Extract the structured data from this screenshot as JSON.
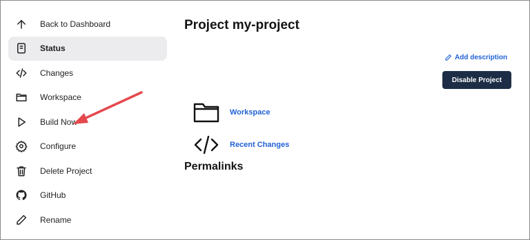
{
  "sidebar": {
    "items": [
      {
        "label": "Back to Dashboard",
        "icon": "arrow-up-icon"
      },
      {
        "label": "Status",
        "icon": "document-icon",
        "active": true
      },
      {
        "label": "Changes",
        "icon": "code-icon"
      },
      {
        "label": "Workspace",
        "icon": "folder-icon"
      },
      {
        "label": "Build Now",
        "icon": "play-icon"
      },
      {
        "label": "Configure",
        "icon": "gear-icon"
      },
      {
        "label": "Delete Project",
        "icon": "trash-icon"
      },
      {
        "label": "GitHub",
        "icon": "github-icon"
      },
      {
        "label": "Rename",
        "icon": "pencil-icon"
      }
    ]
  },
  "main": {
    "title": "Project my-project",
    "add_description": "Add description",
    "disable_button": "Disable Project",
    "links": [
      {
        "label": "Workspace",
        "icon": "folder-icon"
      },
      {
        "label": "Recent Changes",
        "icon": "code-icon"
      }
    ],
    "permalinks_heading": "Permalinks"
  },
  "colors": {
    "accent_link": "#2162d4",
    "button_bg": "#1c2d45",
    "active_item_bg": "#ececef",
    "annotation_arrow": "#e5484d"
  }
}
